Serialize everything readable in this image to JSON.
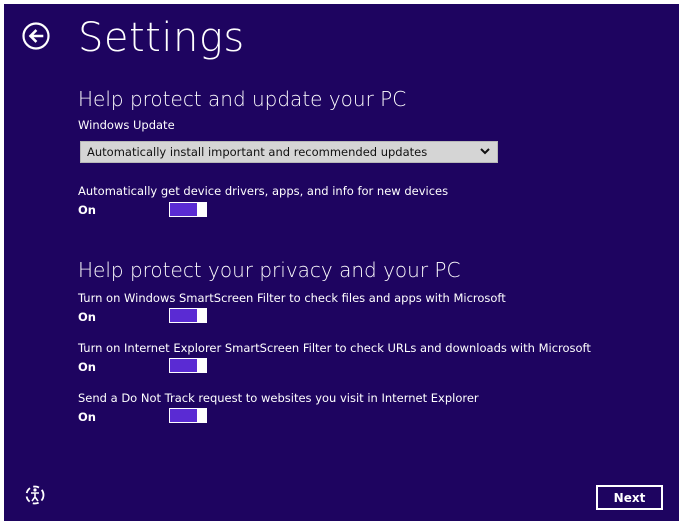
{
  "header": {
    "title": "Settings",
    "back_icon": "back-arrow-icon"
  },
  "sections": {
    "update": {
      "heading": "Help protect and update your PC",
      "windows_update": {
        "label": "Windows Update",
        "selected": "Automatically install important and recommended updates"
      },
      "drivers": {
        "label": "Automatically get device drivers, apps, and info for new devices",
        "state": "On"
      }
    },
    "privacy": {
      "heading": "Help protect your privacy and your PC",
      "smartscreen_windows": {
        "label": "Turn on Windows SmartScreen Filter to check files and apps with Microsoft",
        "state": "On"
      },
      "smartscreen_ie": {
        "label": "Turn on Internet Explorer SmartScreen Filter to check URLs and downloads with Microsoft",
        "state": "On"
      },
      "do_not_track": {
        "label": "Send a Do Not Track request to websites you visit in Internet Explorer",
        "state": "On"
      }
    }
  },
  "footer": {
    "next_label": "Next",
    "accessibility_icon": "ease-of-access-icon"
  },
  "colors": {
    "background": "#1e0460",
    "toggle_on": "#5a2bd3",
    "dropdown_bg": "#d5d5d5"
  }
}
